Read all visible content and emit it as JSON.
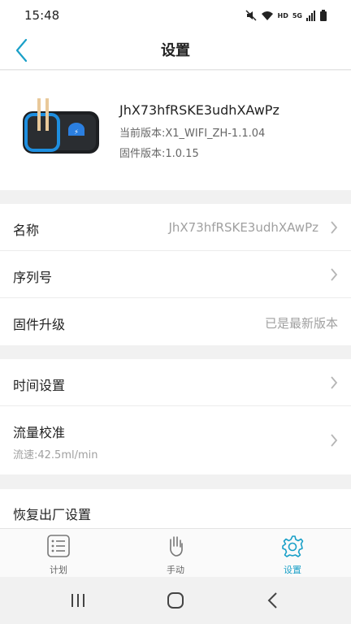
{
  "status": {
    "time": "15:48",
    "hd": "HD",
    "net": "5G"
  },
  "header": {
    "title": "设置"
  },
  "device": {
    "name": "JhX73hfRSKE3udhXAwPz",
    "current_version": "当前版本:X1_WIFI_ZH-1.1.04",
    "firmware_version": "固件版本:1.0.15"
  },
  "settings": {
    "name_label": "名称",
    "name_value": "JhX73hfRSKE3udhXAwPz",
    "serial_label": "序列号",
    "firmware_label": "固件升级",
    "firmware_value": "已是最新版本",
    "time_label": "时间设置",
    "flow_label": "流量校准",
    "flow_sub": "流速:42.5ml/min",
    "reset_label": "恢复出厂设置"
  },
  "tabs": [
    {
      "label": "计划",
      "icon": "list-icon"
    },
    {
      "label": "手动",
      "icon": "hand-icon"
    },
    {
      "label": "设置",
      "icon": "gear-icon"
    }
  ],
  "colors": {
    "accent": "#1aa0c8",
    "muted": "#a0a0a0"
  }
}
